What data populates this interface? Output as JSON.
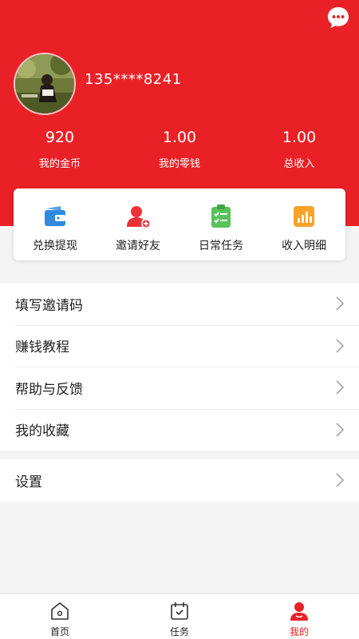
{
  "user": {
    "phone": "135****8241"
  },
  "stats": [
    {
      "value": "920",
      "label": "我的金币"
    },
    {
      "value": "1.00",
      "label": "我的零钱"
    },
    {
      "value": "1.00",
      "label": "总收入"
    }
  ],
  "quick_actions": [
    {
      "label": "兑换提现",
      "icon": "wallet-icon"
    },
    {
      "label": "邀请好友",
      "icon": "invite-friend-icon"
    },
    {
      "label": "日常任务",
      "icon": "daily-task-icon"
    },
    {
      "label": "收入明细",
      "icon": "income-chart-icon"
    }
  ],
  "menu": [
    {
      "label": "填写邀请码"
    },
    {
      "label": "赚钱教程"
    },
    {
      "label": "帮助与反馈"
    },
    {
      "label": "我的收藏"
    }
  ],
  "settings": {
    "label": "设置"
  },
  "tabs": [
    {
      "label": "首页",
      "icon": "home-icon"
    },
    {
      "label": "任务",
      "icon": "task-calendar-icon"
    },
    {
      "label": "我的",
      "icon": "profile-icon"
    }
  ],
  "colors": {
    "brand_red": "#e92127",
    "background": "#f4f4f4",
    "card": "#ffffff"
  }
}
